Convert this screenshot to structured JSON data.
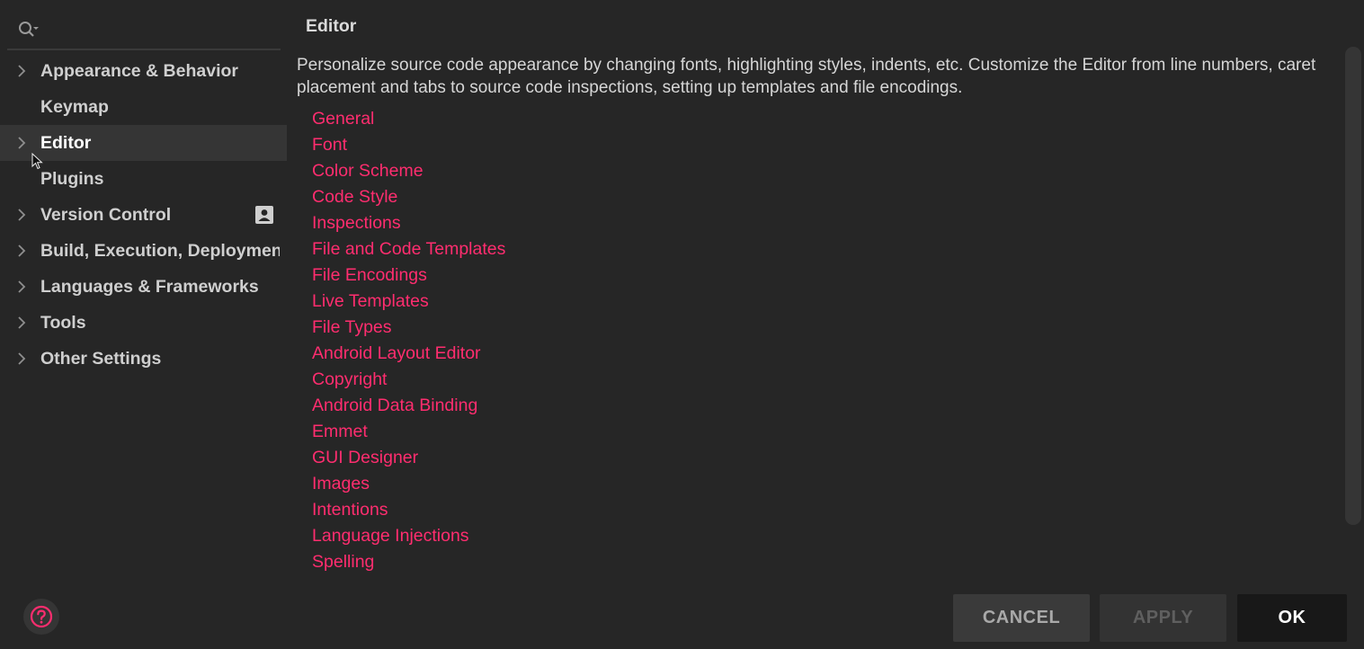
{
  "search": {
    "placeholder": "",
    "value": ""
  },
  "sidebar": {
    "items": [
      {
        "label": "Appearance & Behavior",
        "expandable": true
      },
      {
        "label": "Keymap",
        "expandable": false
      },
      {
        "label": "Editor",
        "expandable": true,
        "selected": true
      },
      {
        "label": "Plugins",
        "expandable": false
      },
      {
        "label": "Version Control",
        "expandable": true,
        "icon": "person-badge-icon"
      },
      {
        "label": "Build, Execution, Deployment",
        "expandable": true
      },
      {
        "label": "Languages & Frameworks",
        "expandable": true
      },
      {
        "label": "Tools",
        "expandable": true
      },
      {
        "label": "Other Settings",
        "expandable": true
      }
    ]
  },
  "main": {
    "title": "Editor",
    "description": "Personalize source code appearance by changing fonts, highlighting styles, indents, etc. Customize the Editor from line numbers, caret placement and tabs to source code inspections, setting up templates and file encodings.",
    "links": [
      "General",
      "Font",
      "Color Scheme",
      "Code Style",
      "Inspections",
      "File and Code Templates",
      "File Encodings",
      "Live Templates",
      "File Types",
      "Android Layout Editor",
      "Copyright",
      "Android Data Binding",
      "Emmet",
      "GUI Designer",
      "Images",
      "Intentions",
      "Language Injections",
      "Spelling"
    ]
  },
  "footer": {
    "cancel_label": "CANCEL",
    "apply_label": "APPLY",
    "ok_label": "OK"
  },
  "colors": {
    "background": "#262626",
    "selected_row": "#353535",
    "link": "#ff2d6f",
    "help_icon": "#ff2d6f"
  }
}
